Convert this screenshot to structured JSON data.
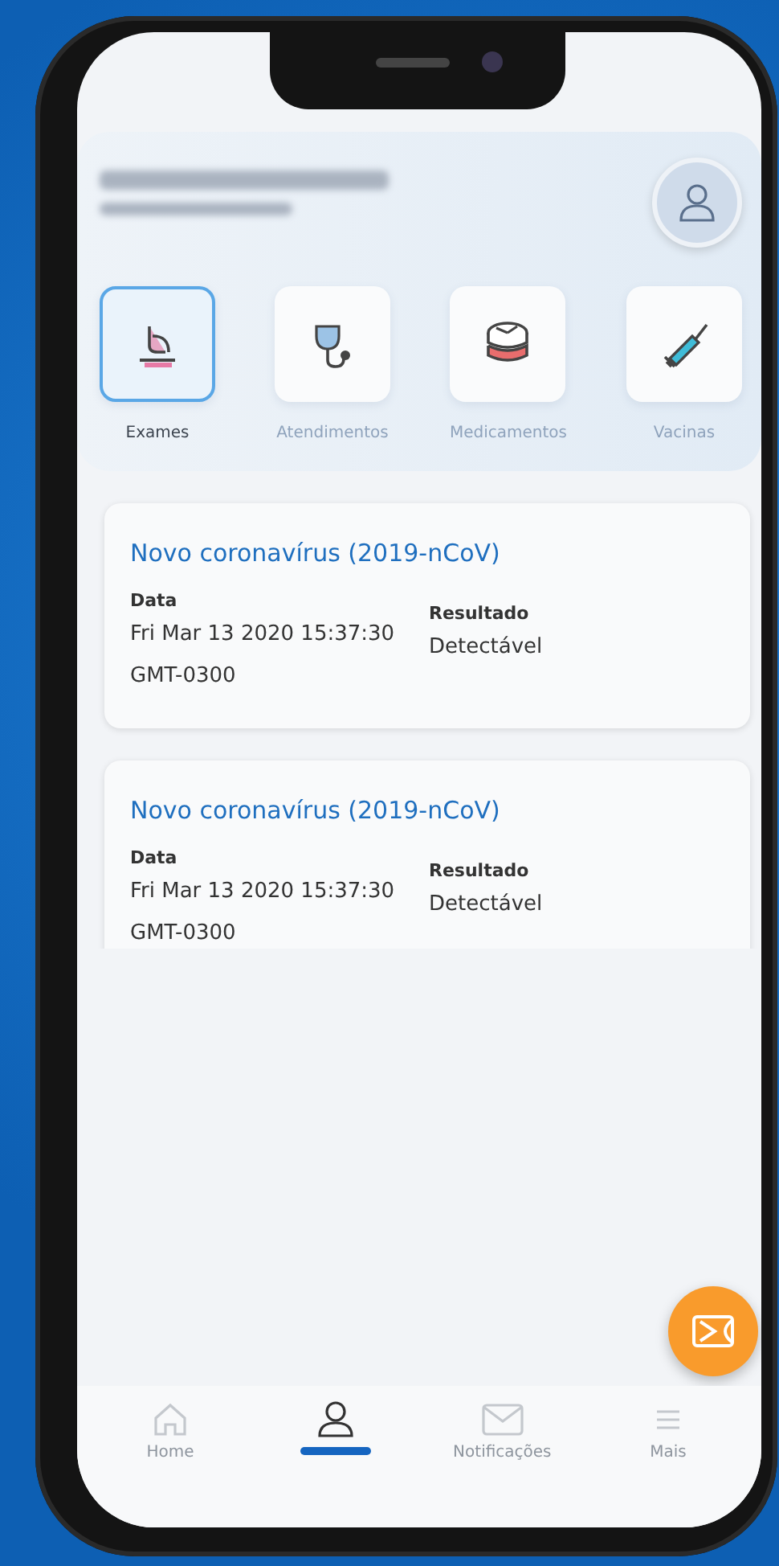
{
  "categories": [
    {
      "kind": "microscope",
      "label": "Exames",
      "selected": true
    },
    {
      "kind": "stethoscope",
      "label": "Atendimentos",
      "selected": false
    },
    {
      "kind": "pills",
      "label": "Medicamentos",
      "selected": false
    },
    {
      "kind": "syringe",
      "label": "Vacinas",
      "selected": false
    }
  ],
  "results": [
    {
      "title": "Novo coronavírus (2019-nCoV)",
      "date_label": "Data",
      "date": "Fri Mar 13 2020 15:37:30 GMT-0300",
      "result_label": "Resultado",
      "result": "Detectável"
    },
    {
      "title": "Novo coronavírus (2019-nCoV)",
      "date_label": "Data",
      "date": "Fri Mar 13 2020 15:37:30 GMT-0300",
      "result_label": "Resultado",
      "result": "Detectável"
    }
  ],
  "bottom_nav": [
    {
      "kind": "home",
      "label": "Home",
      "selected": false
    },
    {
      "kind": "profile",
      "selected": true
    },
    {
      "kind": "mail",
      "label": "Notificações",
      "selected": false
    },
    {
      "kind": "menu",
      "label": "Mais",
      "selected": false
    }
  ]
}
